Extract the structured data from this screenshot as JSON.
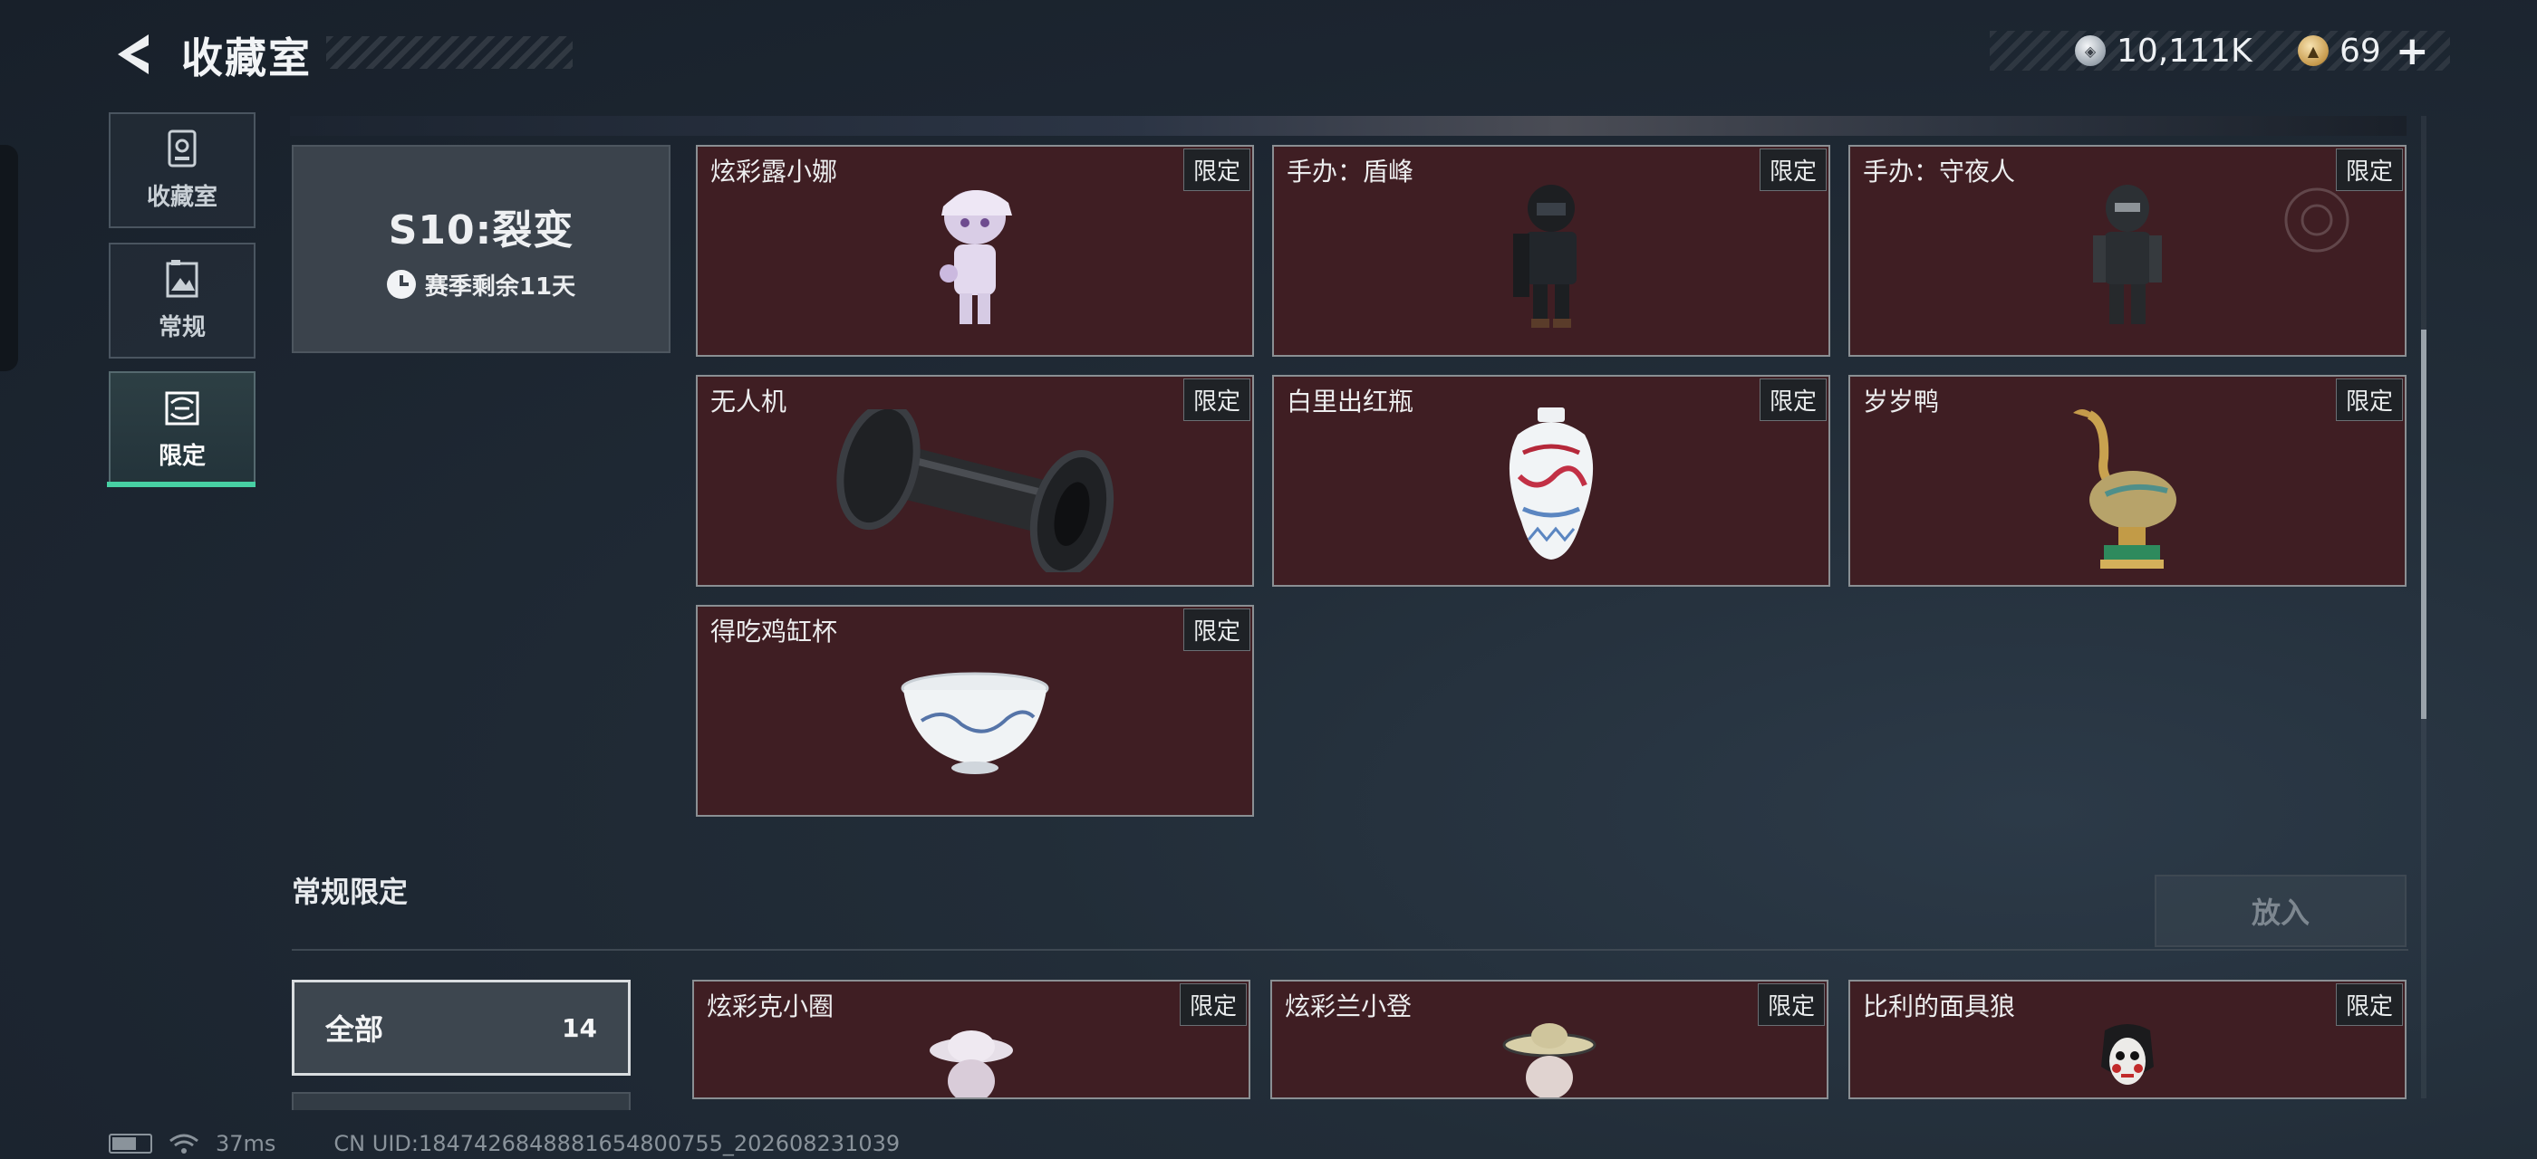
{
  "header": {
    "title": "收藏室",
    "currencies": [
      {
        "icon": "silver-coin-icon",
        "value": "10,111K"
      },
      {
        "icon": "gold-coin-icon",
        "value": "69"
      }
    ],
    "plus": "+"
  },
  "sidebar": {
    "items": [
      {
        "label": "收藏室",
        "icon": "collection-icon"
      },
      {
        "label": "常规",
        "icon": "gallery-icon"
      },
      {
        "label": "限定",
        "icon": "limited-icon",
        "active": true
      }
    ]
  },
  "season": {
    "name": "S10:裂变",
    "remaining": "赛季剩余11天"
  },
  "limited_items": [
    {
      "name": "炫彩露小娜",
      "badge": "限定"
    },
    {
      "name": "手办：盾峰",
      "badge": "限定"
    },
    {
      "name": "手办：守夜人",
      "badge": "限定"
    },
    {
      "name": "无人机",
      "badge": "限定"
    },
    {
      "name": "白里出红瓶",
      "badge": "限定"
    },
    {
      "name": "岁岁鸭",
      "badge": "限定"
    },
    {
      "name": "得吃鸡缸杯",
      "badge": "限定"
    }
  ],
  "regular_section": {
    "title": "常规限定",
    "place_button": "放入",
    "filter": {
      "label": "全部",
      "count": "14"
    },
    "items": [
      {
        "name": "炫彩克小圈",
        "badge": "限定"
      },
      {
        "name": "炫彩兰小登",
        "badge": "限定"
      },
      {
        "name": "比利的面具狼",
        "badge": "限定"
      }
    ]
  },
  "status": {
    "ping": "37ms",
    "uid": "CN UID:1847426848881654800755_202608231039"
  },
  "colors": {
    "accent": "#47d0a3",
    "card_bg": "#3f1e23"
  }
}
